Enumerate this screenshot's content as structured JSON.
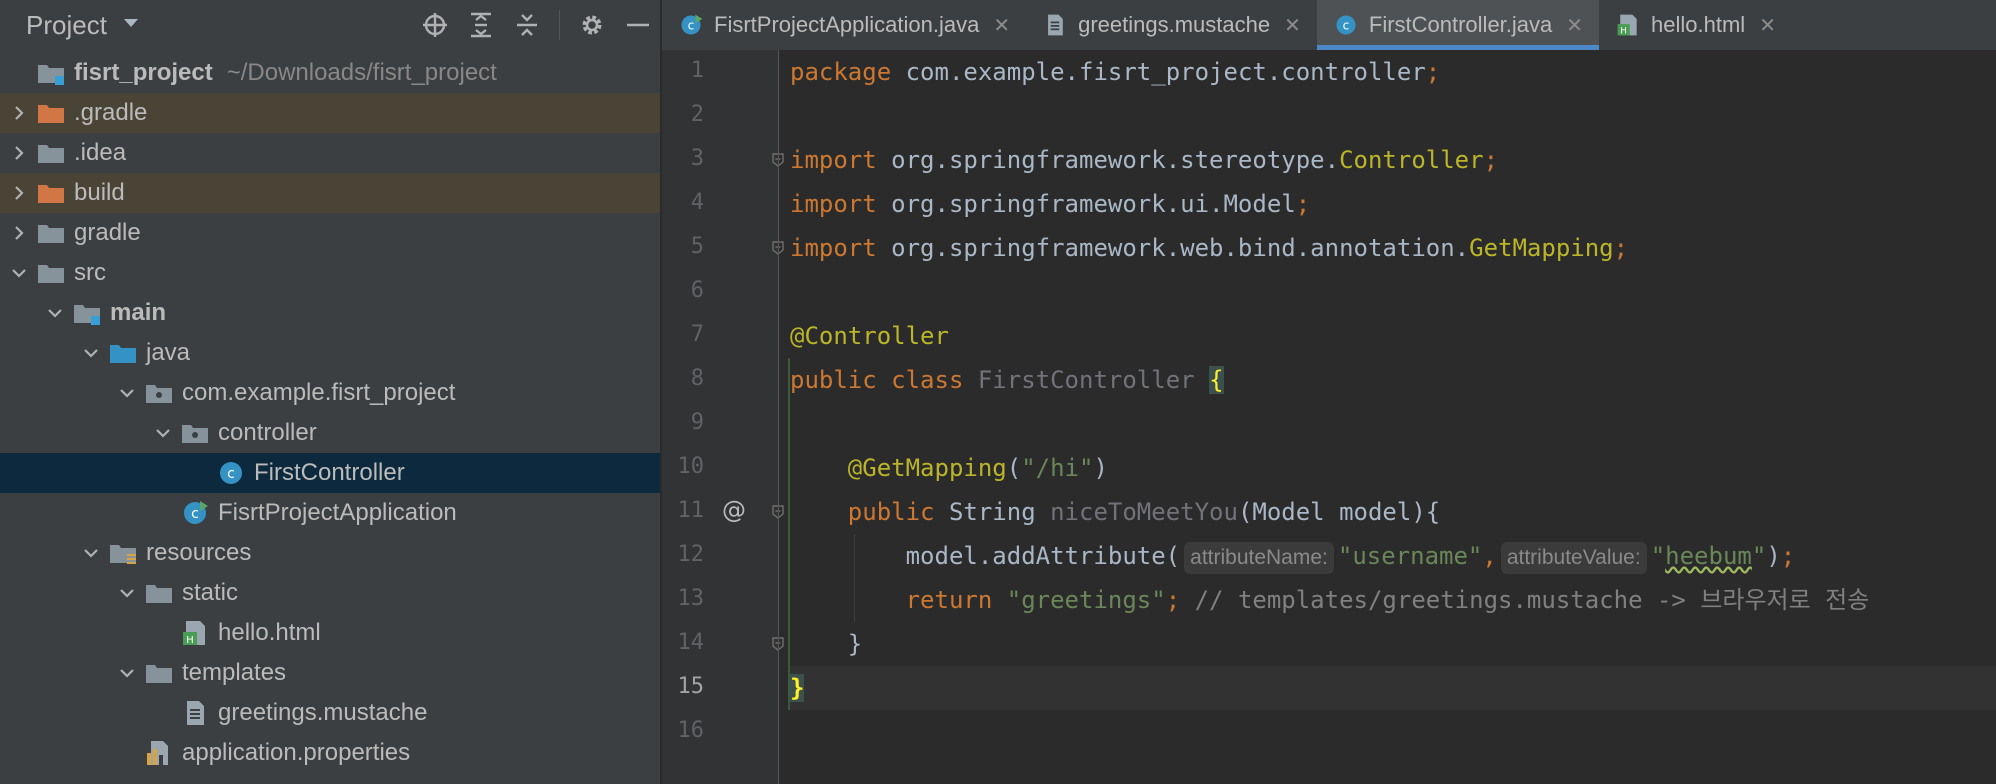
{
  "project_panel": {
    "title": "Project",
    "tree": [
      {
        "label": "fisrt_project",
        "hint": "~/Downloads/fisrt_project",
        "kind": "module",
        "depth": 0,
        "arrow": "none",
        "bold": true
      },
      {
        "label": ".gradle",
        "kind": "folder-excluded",
        "depth": 0,
        "arrow": "right"
      },
      {
        "label": ".idea",
        "kind": "folder",
        "depth": 0,
        "arrow": "right"
      },
      {
        "label": "build",
        "kind": "folder-excluded",
        "depth": 0,
        "arrow": "right"
      },
      {
        "label": "gradle",
        "kind": "folder",
        "depth": 0,
        "arrow": "right"
      },
      {
        "label": "src",
        "kind": "folder",
        "depth": 0,
        "arrow": "down"
      },
      {
        "label": "main",
        "kind": "folder-module",
        "depth": 1,
        "arrow": "down",
        "bold": true
      },
      {
        "label": "java",
        "kind": "folder-source",
        "depth": 2,
        "arrow": "down"
      },
      {
        "label": "com.example.fisrt_project",
        "kind": "package",
        "depth": 3,
        "arrow": "down"
      },
      {
        "label": "controller",
        "kind": "package",
        "depth": 4,
        "arrow": "down"
      },
      {
        "label": "FirstController",
        "kind": "class",
        "depth": 5,
        "arrow": "none"
      },
      {
        "label": "FisrtProjectApplication",
        "kind": "class-run",
        "depth": 4,
        "arrow": "none"
      },
      {
        "label": "resources",
        "kind": "folder-resources",
        "depth": 2,
        "arrow": "down"
      },
      {
        "label": "static",
        "kind": "folder",
        "depth": 3,
        "arrow": "down"
      },
      {
        "label": "hello.html",
        "kind": "html-file",
        "depth": 4,
        "arrow": "none"
      },
      {
        "label": "templates",
        "kind": "folder",
        "depth": 3,
        "arrow": "down"
      },
      {
        "label": "greetings.mustache",
        "kind": "text-file",
        "depth": 4,
        "arrow": "none"
      },
      {
        "label": "application.properties",
        "kind": "properties-file",
        "depth": 3,
        "arrow": "none"
      }
    ],
    "selected_item": "FirstController",
    "tool_icons": [
      "locate-icon",
      "expand-all-icon",
      "collapse-all-icon",
      "gear-icon",
      "hide-icon"
    ]
  },
  "editor": {
    "tabs": [
      {
        "label": "FisrtProjectApplication.java",
        "icon": "class-run",
        "active": false
      },
      {
        "label": "greetings.mustache",
        "icon": "text-file",
        "active": false
      },
      {
        "label": "FirstController.java",
        "icon": "class",
        "active": true
      },
      {
        "label": "hello.html",
        "icon": "html-file",
        "active": false
      }
    ],
    "current_line": 15,
    "lines": [
      {
        "n": "1"
      },
      {
        "n": "2"
      },
      {
        "n": "3"
      },
      {
        "n": "4"
      },
      {
        "n": "5"
      },
      {
        "n": "6"
      },
      {
        "n": "7"
      },
      {
        "n": "8"
      },
      {
        "n": "9"
      },
      {
        "n": "10"
      },
      {
        "n": "11"
      },
      {
        "n": "12"
      },
      {
        "n": "13"
      },
      {
        "n": "14"
      },
      {
        "n": "15"
      },
      {
        "n": "16"
      }
    ],
    "gutter_marker_line_11": "@",
    "code": {
      "l1_kw": "package",
      "l1_rest": " com.example.fisrt_project.controller",
      "semicolon": ";",
      "import_kw": "import",
      "l3_pkg": " org.springframework.stereotype.",
      "l3_cls": "Controller",
      "l4_pkg": " org.springframework.ui.Model",
      "l5_pkg": " org.springframework.web.bind.annotation.",
      "l5_cls": "GetMapping",
      "l7_ann": "@Controller",
      "l8_public": "public",
      "l8_class": "class",
      "l8_name": "FirstController",
      "open_brace": "{",
      "l10_indent": "    ",
      "l10_ann": "@GetMapping",
      "l10_open": "(",
      "l10_str": "\"/hi\"",
      "l10_close": ")",
      "l11_indent": "    ",
      "l11_public": "public",
      "l11_type": " String ",
      "l11_method": "niceToMeetYou",
      "l11_params": "(Model model){",
      "l12_indent": "        ",
      "l12_call": "model.addAttribute(",
      "l12_hint1": "attributeName:",
      "l12_str1": "\"username\"",
      "l12_comma": ",",
      "l12_hint2": "attributeValue:",
      "l12_q1": "\"",
      "l12_val": "heebum",
      "l12_q2": "\"",
      "l12_end": ")",
      "l13_indent": "        ",
      "l13_return": "return",
      "l13_str": " \"greetings\"",
      "l13_comment": " // templates/greetings.mustache -> 브라우저로 전송",
      "l14_indent": "    ",
      "close_brace": "}"
    }
  },
  "colors": {
    "keyword": "#cc7832",
    "annotation": "#bbb529",
    "string": "#6a8759",
    "comment": "#808080",
    "selection": "#0d293e",
    "excluded_folder": "#4a4436",
    "active_tab_underline": "#4a88c7"
  }
}
